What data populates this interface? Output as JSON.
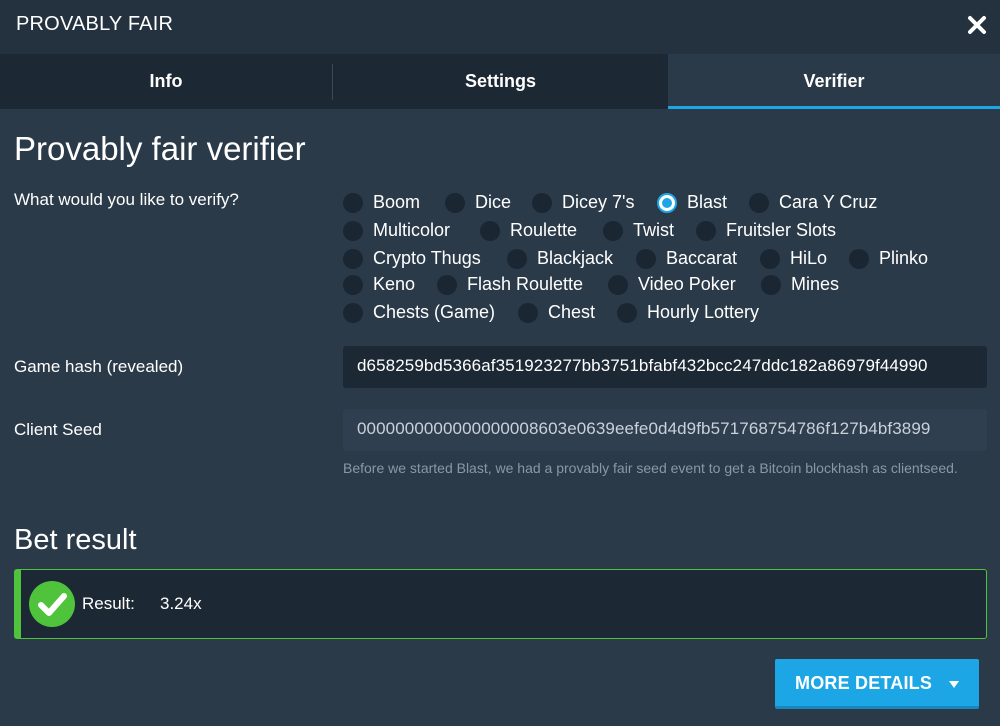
{
  "header": {
    "title": "PROVABLY FAIR",
    "close_icon": "close-icon"
  },
  "tabs": [
    {
      "label": "Info"
    },
    {
      "label": "Settings"
    },
    {
      "label": "Verifier",
      "active": true
    }
  ],
  "verifier": {
    "title": "Provably fair verifier",
    "question": "What would you like to verify?",
    "selected_game": "Blast",
    "games": [
      "Boom",
      "Dice",
      "Dicey 7's",
      "Blast",
      "Cara Y Cruz",
      "Multicolor",
      "Roulette",
      "Twist",
      "Fruitsler Slots",
      "Crypto Thugs",
      "Blackjack",
      "Baccarat",
      "HiLo",
      "Plinko",
      "Keno",
      "Flash Roulette",
      "Video Poker",
      "Mines",
      "Chests (Game)",
      "Chest",
      "Hourly Lottery"
    ],
    "game_hash_label": "Game hash (revealed)",
    "game_hash_value": "d658259bd5366af351923277bb3751bfabf432bcc247ddc182a86979f44990",
    "client_seed_label": "Client Seed",
    "client_seed_value": "0000000000000000008603e0639eefe0d4d9fb571768754786f127b4bf3899",
    "client_seed_help": "Before we started Blast, we had a provably fair seed event to get a Bitcoin blockhash as clientseed."
  },
  "bet_result": {
    "title": "Bet result",
    "result_label": "Result:",
    "result_value": "3.24x",
    "status_icon": "check-circle-icon",
    "status_color": "#4fc33b"
  },
  "actions": {
    "more_details_label": "MORE DETAILS",
    "accent_color": "#1da6e6"
  }
}
